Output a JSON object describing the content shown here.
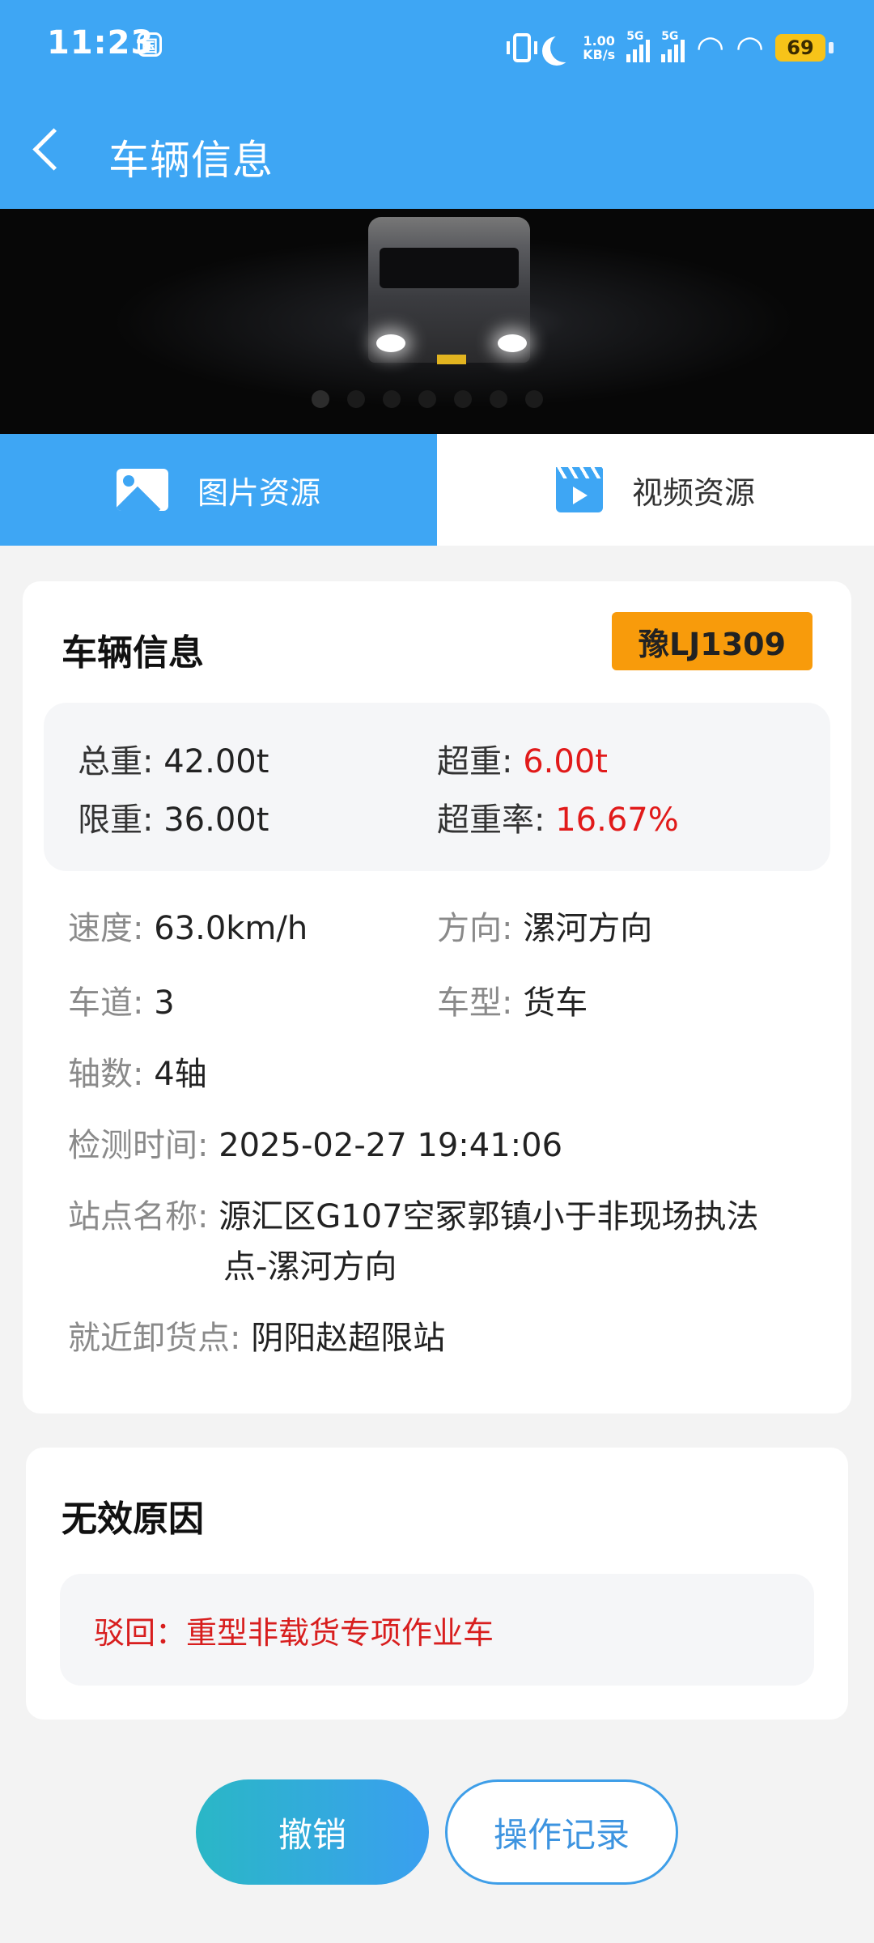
{
  "status_bar": {
    "time": "11:23",
    "sim_label": "国",
    "net_speed_value": "1.00",
    "net_speed_unit": "KB/s",
    "signal1_label": "5G",
    "signal2_label": "5G",
    "battery": "69"
  },
  "header": {
    "title": "车辆信息"
  },
  "media_tabs": [
    {
      "label": "图片资源",
      "active": true
    },
    {
      "label": "视频资源",
      "active": false
    }
  ],
  "vehicle": {
    "section_title": "车辆信息",
    "plate": "豫LJ1309",
    "weights": {
      "total_label": "总重:",
      "total_value": "42.00t",
      "over_label": "超重:",
      "over_value": "6.00t",
      "limit_label": "限重:",
      "limit_value": "36.00t",
      "rate_label": "超重率:",
      "rate_value": "16.67%"
    },
    "speed_label": "速度:",
    "speed_value": "63.0km/h",
    "direction_label": "方向:",
    "direction_value": "漯河方向",
    "lane_label": "车道:",
    "lane_value": "3",
    "type_label": "车型:",
    "type_value": "货车",
    "axles_label": "轴数:",
    "axles_value": "4轴",
    "time_label": "检测时间:",
    "time_value": "2025-02-27 19:41:06",
    "station_label": "站点名称:",
    "station_line1": "源汇区G107空冢郭镇小于非现场执法",
    "station_line2": "点-漯河方向",
    "unload_label": "就近卸货点:",
    "unload_value": "阴阳赵超限站"
  },
  "invalid": {
    "section_title": "无效原因",
    "reason": "驳回：重型非载货专项作业车"
  },
  "actions": {
    "revoke": "撤销",
    "log": "操作记录"
  },
  "colors": {
    "primary": "#3ea6f4",
    "plate_bg": "#f89b0b",
    "alert": "#e11a1a"
  }
}
